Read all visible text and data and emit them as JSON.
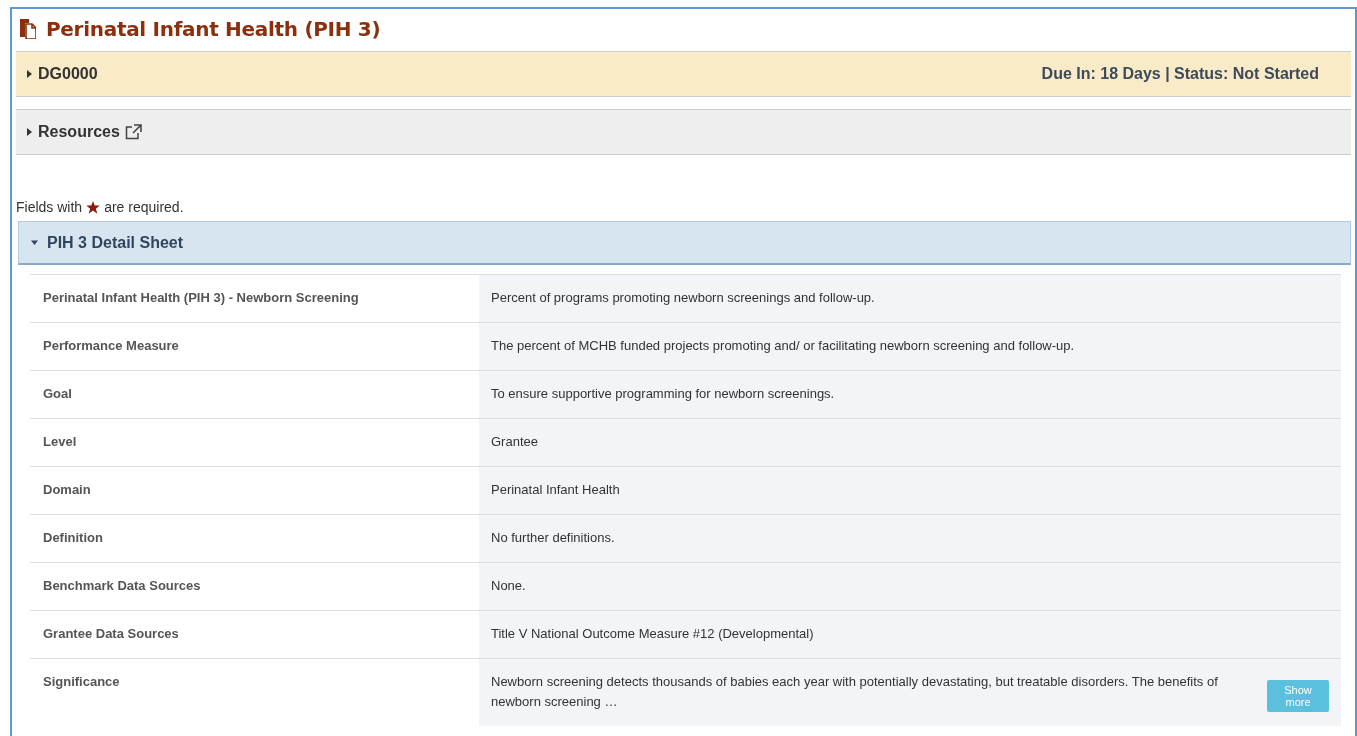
{
  "page_title": "Perinatal Infant Health (PIH 3)",
  "sections": [
    {
      "kind": "record",
      "label": "DG0000",
      "expanded": false,
      "info": "Due In: 18 Days | Status: Not Started"
    },
    {
      "kind": "link",
      "label": "Resources",
      "expanded": false
    }
  ],
  "required_note": {
    "before": "Fields with",
    "after": "are required."
  },
  "detail_sheet": {
    "title": "PIH 3 Detail Sheet",
    "expanded": true,
    "rows": [
      {
        "label": "Perinatal Infant Health (PIH 3) - Newborn Screening",
        "value": "Percent of programs promoting newborn screenings and follow-up."
      },
      {
        "label": "Performance Measure",
        "value": "The percent of MCHB funded projects promoting and/ or facilitating newborn screening and follow-up."
      },
      {
        "label": "Goal",
        "value": "To ensure supportive programming for newborn screenings."
      },
      {
        "label": "Level",
        "value": "Grantee"
      },
      {
        "label": "Domain",
        "value": "Perinatal Infant Health"
      },
      {
        "label": "Definition",
        "value": "No further definitions."
      },
      {
        "label": "Benchmark Data Sources",
        "value": "None."
      },
      {
        "label": "Grantee Data Sources",
        "value": "Title V National Outcome Measure #12 (Developmental)"
      },
      {
        "label": "Significance",
        "value": "Newborn screening detects thousands of babies each year with potentially devastating, but treatable disorders. The benefits of newborn screening …",
        "button": "Show more"
      }
    ]
  }
}
